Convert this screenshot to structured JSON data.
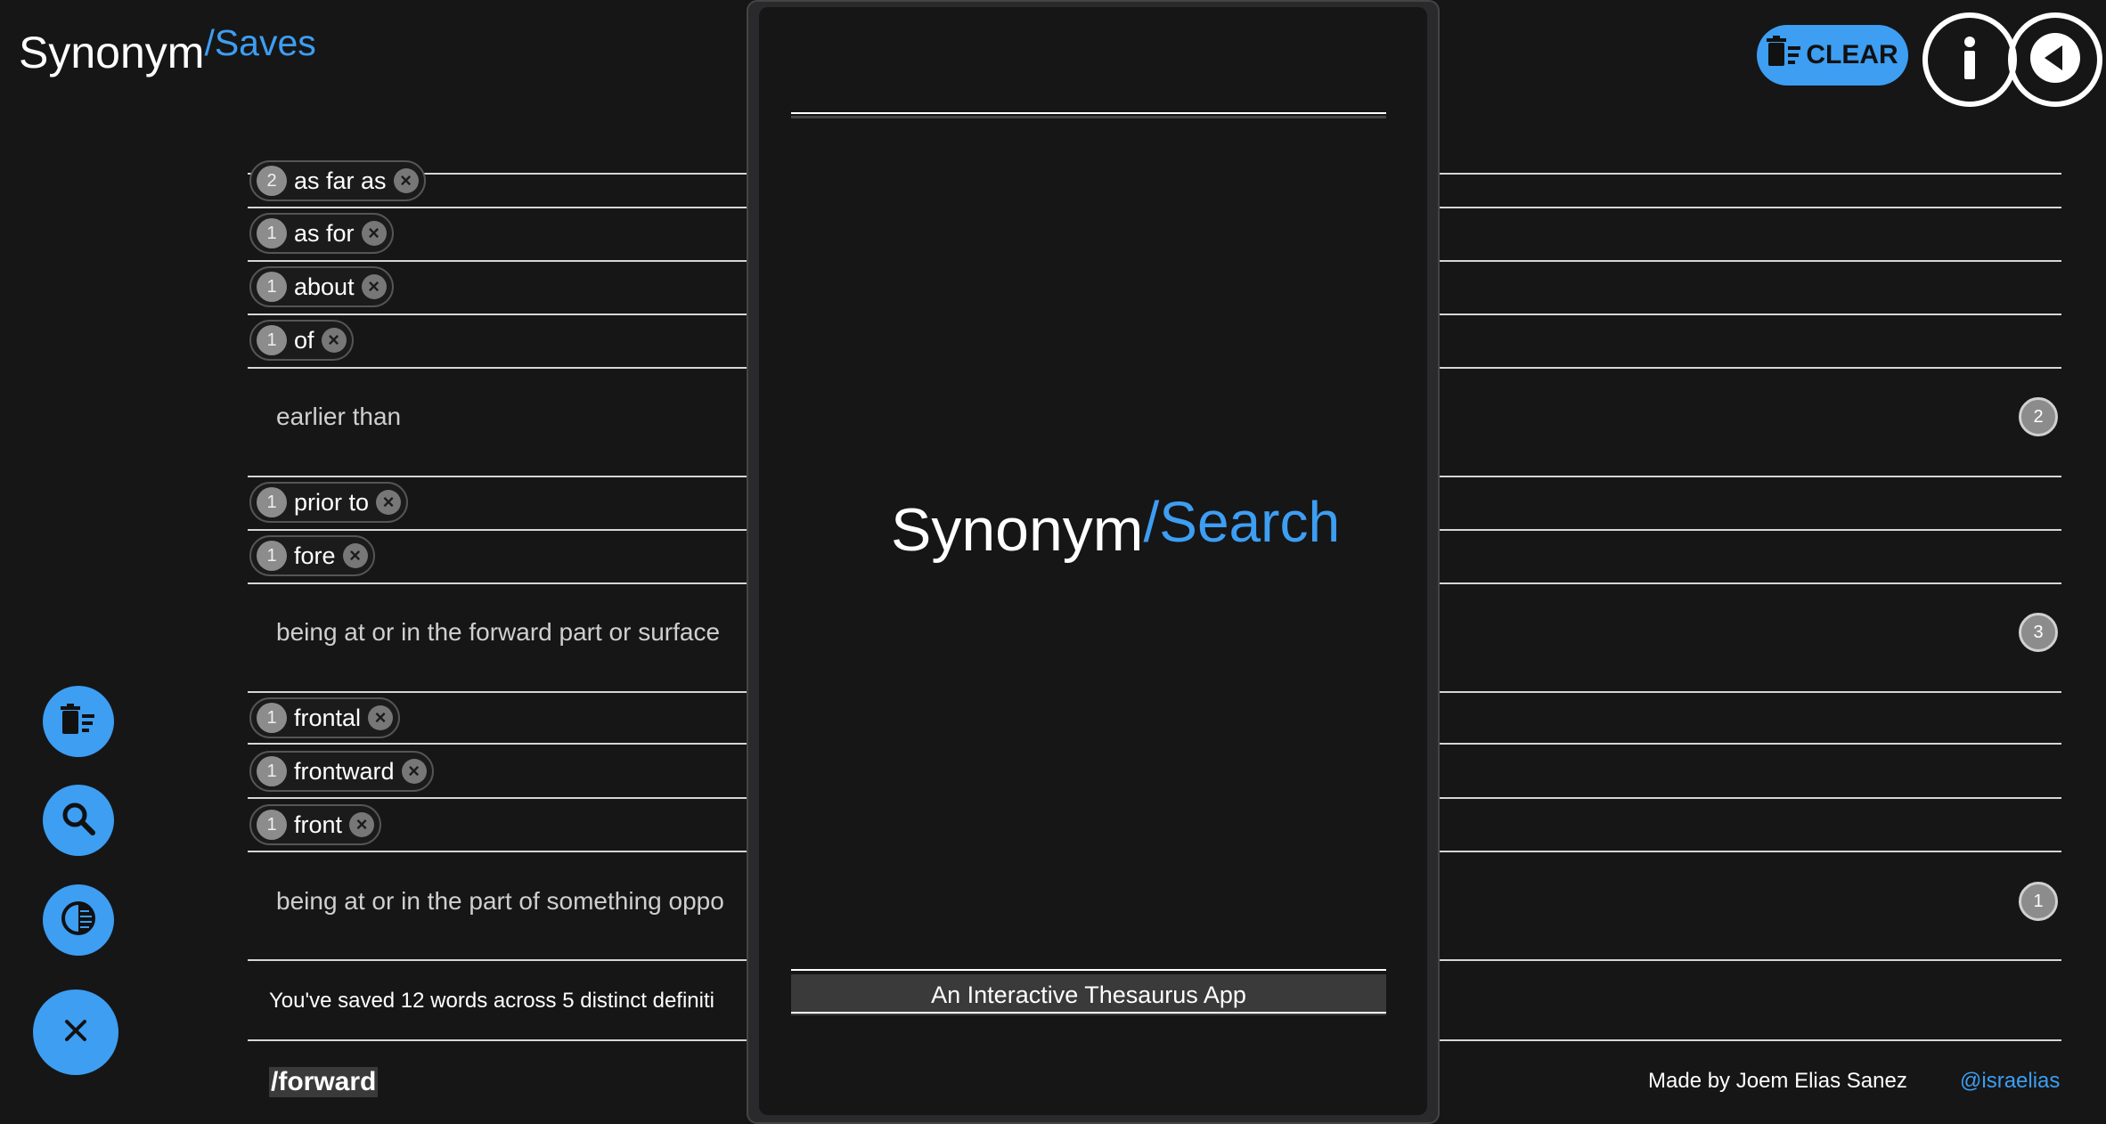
{
  "header": {
    "brand": "Synonym",
    "brand_accent": "/Saves",
    "clear_label": "CLEAR"
  },
  "groups": [
    {
      "definition": "",
      "words": [
        {
          "count": "2",
          "word": "as far as"
        },
        {
          "count": "1",
          "word": "as for"
        },
        {
          "count": "1",
          "word": "about"
        },
        {
          "count": "1",
          "word": "of"
        }
      ]
    },
    {
      "definition": "earlier than",
      "definition_count": "2",
      "words": [
        {
          "count": "1",
          "word": "prior to"
        },
        {
          "count": "1",
          "word": "fore"
        }
      ]
    },
    {
      "definition": "being at or in the forward part or surface",
      "definition_count": "3",
      "words": [
        {
          "count": "1",
          "word": "frontal"
        },
        {
          "count": "1",
          "word": "frontward"
        },
        {
          "count": "1",
          "word": "front"
        }
      ]
    },
    {
      "definition": "being at or in the part of something oppo",
      "definition_count": "1",
      "words": []
    }
  ],
  "summary": "You've saved 12 words across 5 distinct definiti",
  "footer": {
    "slug": "/forward",
    "credit": "Made by Joem Elias Sanez",
    "handle": "@israelias"
  },
  "modal": {
    "brand": "Synonym",
    "brand_accent": "/Search",
    "tagline": "An Interactive Thesaurus App"
  },
  "colors": {
    "accent": "#3d9ef2",
    "background": "#161617"
  },
  "icons": {
    "clear": "trash-list-icon",
    "info": "info-icon",
    "back": "back-arrow-icon",
    "fab_delete": "trash-list-icon",
    "fab_search": "search-icon",
    "fab_theme": "contrast-icon",
    "fab_close": "close-icon"
  }
}
